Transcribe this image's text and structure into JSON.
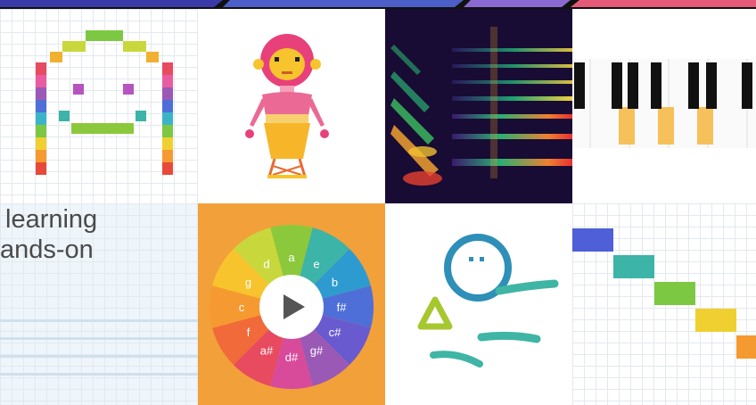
{
  "overlay_text": {
    "line1": "learning",
    "line2": "ands-on"
  },
  "wheel_notes": [
    "a",
    "e",
    "b",
    "f#",
    "c#",
    "g#",
    "d#",
    "a#",
    "f",
    "c",
    "g",
    "d"
  ],
  "colors": {
    "top_band_left": "#3a3aa8",
    "top_band_right": "#e45a78",
    "pixel_face": "#e84a5f",
    "robot_pink": "#e8407a",
    "robot_yellow": "#f7c42d",
    "wheel_center": "#ffffff",
    "piano_key_highlight": "#f6c05a",
    "doodle_blue": "#2e8fb8",
    "doodle_teal": "#3fb5a5",
    "doodle_green": "#a6c72e"
  },
  "icons": {
    "play": "play-icon"
  }
}
